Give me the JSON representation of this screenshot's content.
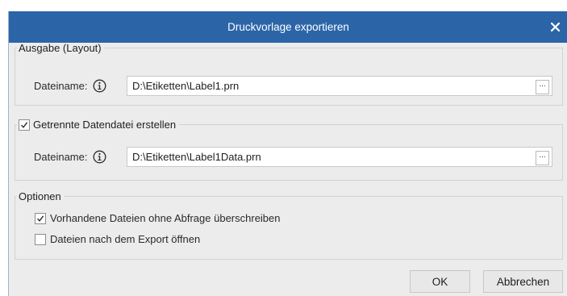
{
  "dialog": {
    "title": "Druckvorlage exportieren",
    "close_icon": "close-icon"
  },
  "layout_group": {
    "legend": "Ausgabe (Layout)",
    "filename_label": "Dateiname:",
    "info_icon": "info-icon",
    "filename_value": "D:\\Etiketten\\Label1.prn",
    "browse_label": "..."
  },
  "data_group": {
    "legend": "Getrennte Datendatei erstellen",
    "checked": true,
    "filename_label": "Dateiname:",
    "info_icon": "info-icon",
    "filename_value": "D:\\Etiketten\\Label1Data.prn",
    "browse_label": "..."
  },
  "options_group": {
    "legend": "Optionen",
    "overwrite_label": "Vorhandene Dateien ohne Abfrage überschreiben",
    "overwrite_checked": true,
    "open_after_label": "Dateien nach dem Export öffnen",
    "open_after_checked": false
  },
  "buttons": {
    "ok": "OK",
    "cancel": "Abbrechen"
  },
  "colors": {
    "titlebar": "#2b65a8",
    "dialog_bg": "#ececec"
  }
}
